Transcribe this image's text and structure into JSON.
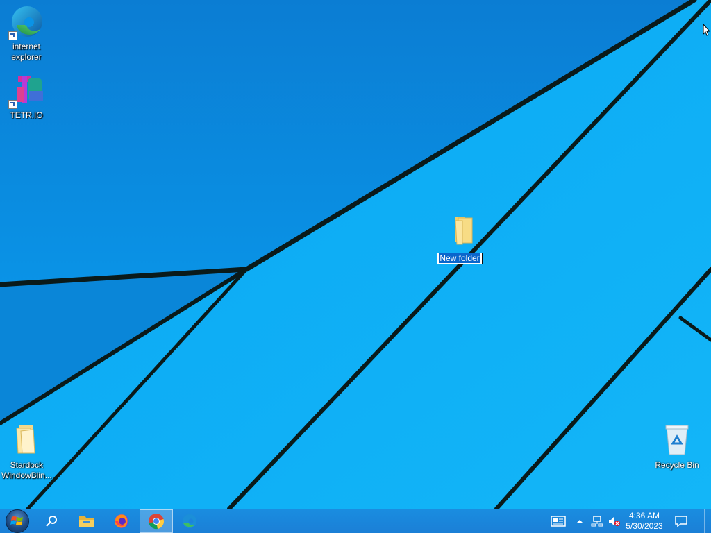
{
  "desktop": {
    "icons": [
      {
        "label": "internet\nexplorer",
        "icon": "edge-icon"
      },
      {
        "label": "TETR.IO",
        "icon": "tetrio-icon"
      },
      {
        "label": "Stardock\nWindowBlin...",
        "icon": "folder-icon"
      },
      {
        "label": "Recycle Bin",
        "icon": "recycle-bin-icon"
      }
    ],
    "rename": {
      "value": "New folder",
      "icon": "folder-icon"
    }
  },
  "taskbar": {
    "start": {
      "icon": "windows-logo-icon"
    },
    "search": {
      "icon": "search-icon"
    },
    "pinned": [
      {
        "name": "File Explorer",
        "icon": "file-explorer-icon"
      },
      {
        "name": "Firefox",
        "icon": "firefox-icon"
      },
      {
        "name": "Chrome",
        "icon": "chrome-icon",
        "active": true
      },
      {
        "name": "Edge",
        "icon": "edge-icon"
      }
    ],
    "tray": {
      "news_icon": "news-icon",
      "overflow_icon": "chevron-up-icon",
      "network_icon": "network-icon",
      "volume_icon": "volume-muted-icon",
      "time": "4:36 AM",
      "date": "5/30/2023",
      "notification_icon": "notification-icon"
    }
  },
  "colors": {
    "wallpaper": "#0aa0f0",
    "taskbar": "#1b84db",
    "selection": "#0a66cc"
  }
}
